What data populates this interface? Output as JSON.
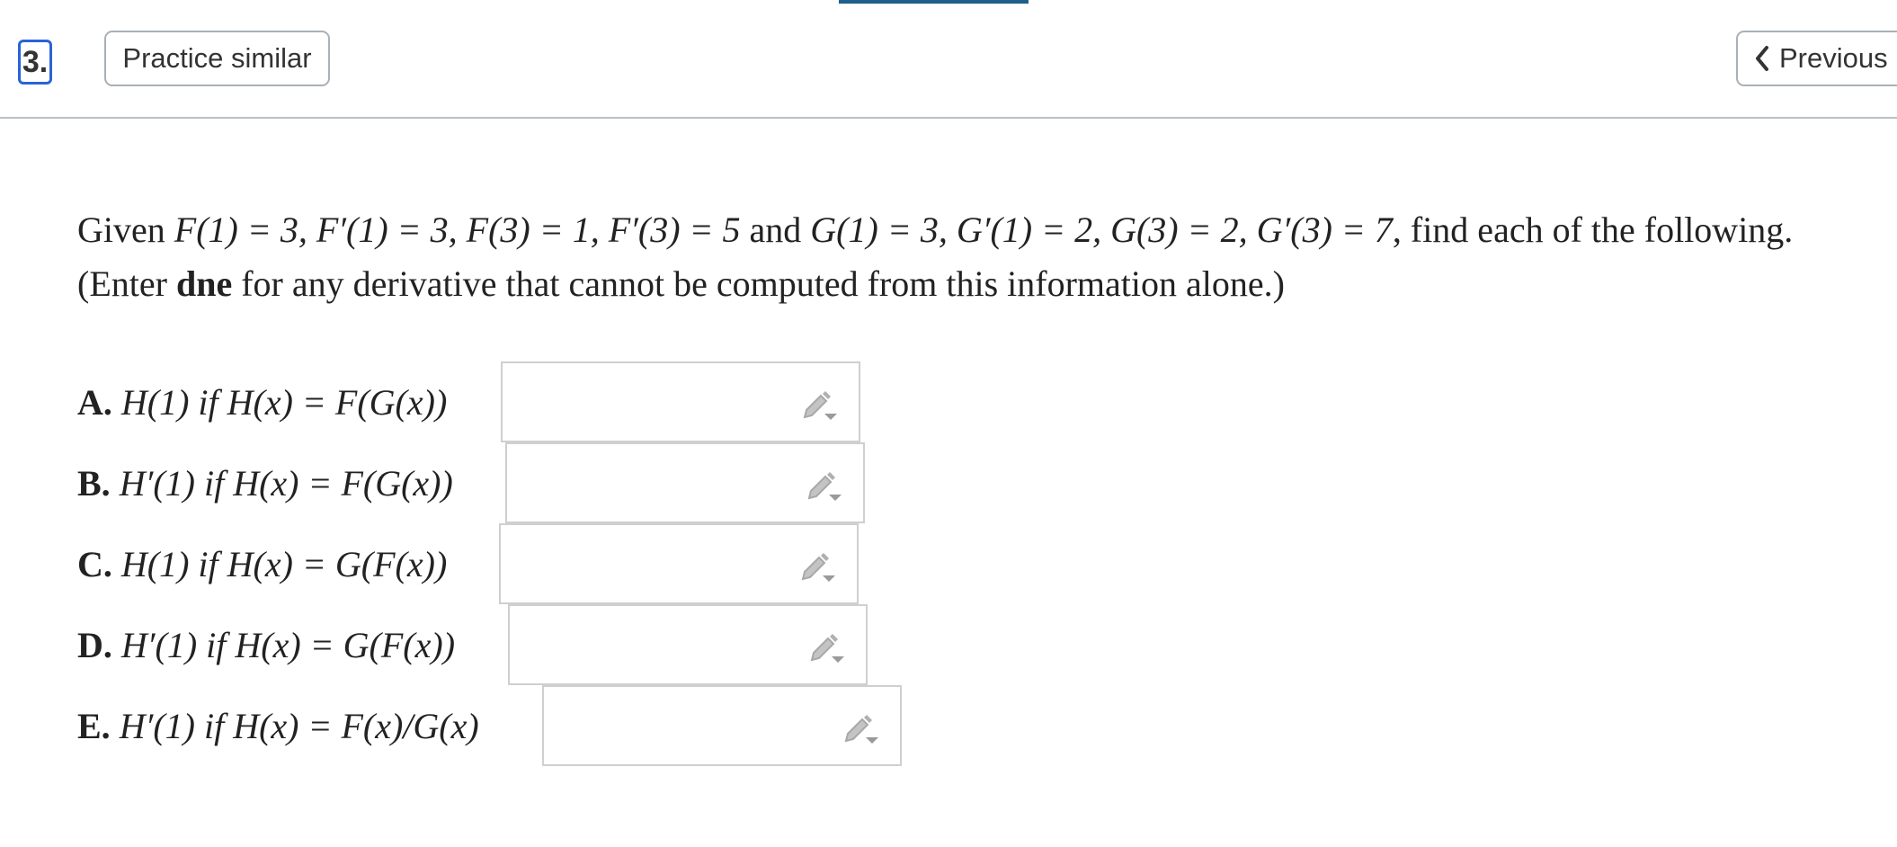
{
  "header": {
    "question_number": "3.",
    "practice_label": "Practice similar",
    "previous_label": "Previous"
  },
  "problem": {
    "line1_lead": "Given ",
    "line1_math": "F(1) = 3, F′(1) = 3, F(3) = 1, F′(3) = 5",
    "line1_and": " and ",
    "line1_math2": "G(1) = 3, G′(1) = 2, G(3) = 2, G′(3) = 7",
    "line1_tail": ", find each of the following.",
    "line2_lead": "(Enter ",
    "line2_bold": "dne",
    "line2_tail": " for any derivative that cannot be computed from this information alone.)"
  },
  "parts": [
    {
      "letter": "A.",
      "expr": "H(1) if H(x) = F(G(x))",
      "value": ""
    },
    {
      "letter": "B.",
      "expr": "H′(1) if H(x) = F(G(x))",
      "value": ""
    },
    {
      "letter": "C.",
      "expr": "H(1) if H(x) = G(F(x))",
      "value": ""
    },
    {
      "letter": "D.",
      "expr": "H′(1) if H(x) = G(F(x))",
      "value": ""
    },
    {
      "letter": "E.",
      "expr": "H′(1) if H(x) = F(x)/G(x)",
      "value": ""
    }
  ],
  "icons": {
    "answer_tool": "pencil-dropdown-icon",
    "previous": "chevron-left-icon"
  },
  "colors": {
    "accent": "#1f5f8b",
    "focus": "#2a63d8",
    "icon_gray": "#b3b3b3"
  }
}
